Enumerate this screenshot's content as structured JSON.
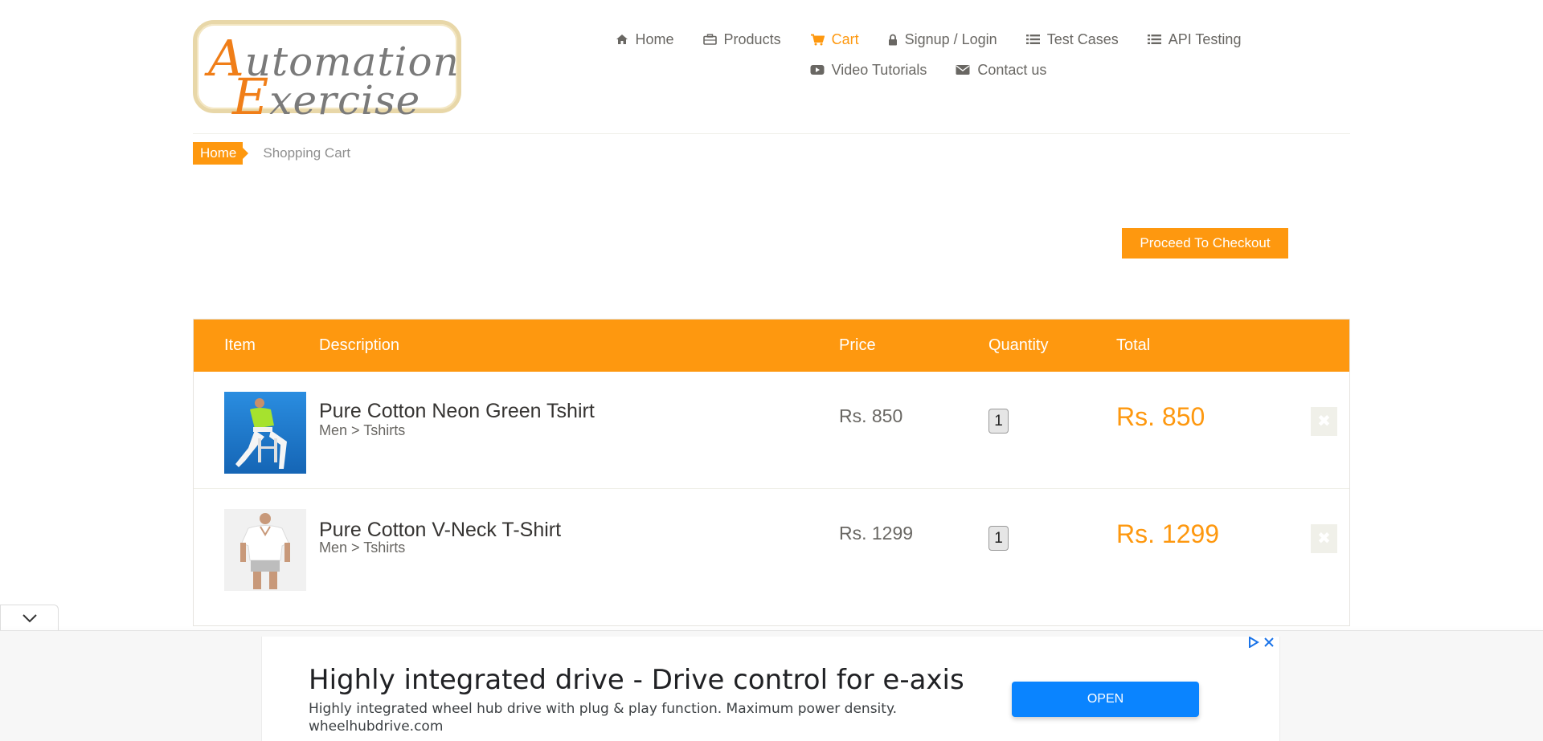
{
  "logo": {
    "line1_cap": "A",
    "line1_rest": "utomation",
    "line2_cap": "E",
    "line2_rest": "xercise"
  },
  "nav": {
    "row1": [
      {
        "label": "Home",
        "icon": "home-icon"
      },
      {
        "label": "Products",
        "icon": "briefcase-icon"
      },
      {
        "label": "Cart",
        "icon": "cart-icon",
        "active": true
      },
      {
        "label": "Signup / Login",
        "icon": "lock-icon"
      },
      {
        "label": "Test Cases",
        "icon": "list-icon"
      },
      {
        "label": "API Testing",
        "icon": "list-icon"
      }
    ],
    "row2": [
      {
        "label": "Video Tutorials",
        "icon": "youtube-play-icon"
      },
      {
        "label": "Contact us",
        "icon": "envelope-icon"
      }
    ]
  },
  "breadcrumb": {
    "home": "Home",
    "current": "Shopping Cart"
  },
  "checkout": {
    "label": "Proceed To Checkout"
  },
  "cart": {
    "headers": {
      "item": "Item",
      "description": "Description",
      "price": "Price",
      "quantity": "Quantity",
      "total": "Total"
    },
    "items": [
      {
        "name": "Pure Cotton Neon Green Tshirt",
        "category": "Men > Tshirts",
        "price": "Rs. 850",
        "quantity": "1",
        "total": "Rs. 850",
        "delete": "✖"
      },
      {
        "name": "Pure Cotton V-Neck T-Shirt",
        "category": "Men > Tshirts",
        "price": "Rs. 1299",
        "quantity": "1",
        "total": "Rs. 1299",
        "delete": "✖"
      }
    ]
  },
  "ad": {
    "title": "Highly integrated drive - Drive control for e-axis",
    "description": "Highly integrated wheel hub drive with plug & play function. Maximum power density.",
    "url": "wheelhubdrive.com",
    "open_label": "OPEN"
  },
  "colors": {
    "accent": "#fe980f",
    "text": "#696763",
    "ad_button": "#0a84ff"
  }
}
